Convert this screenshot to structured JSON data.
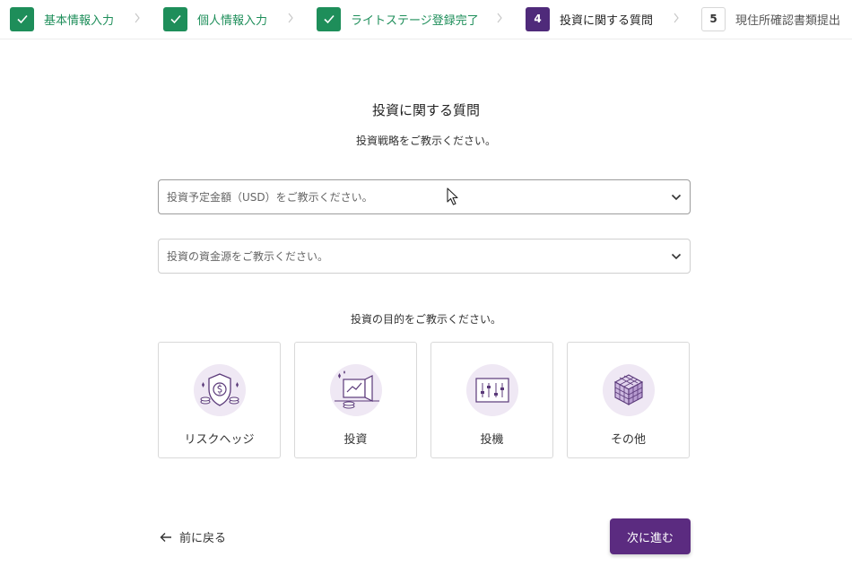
{
  "stepper": {
    "steps": [
      {
        "label": "基本情報入力",
        "status": "done"
      },
      {
        "label": "個人情報入力",
        "status": "done"
      },
      {
        "label": "ライトステージ登録完了",
        "status": "done"
      },
      {
        "number": "4",
        "label": "投資に関する質問",
        "status": "current"
      },
      {
        "number": "5",
        "label": "現住所確認書類提出",
        "status": "future"
      }
    ]
  },
  "main": {
    "title": "投資に関する質問",
    "subtitle": "投資戦略をご教示ください。",
    "amount_select": {
      "placeholder": "投資予定金額（USD）をご教示ください。"
    },
    "source_select": {
      "placeholder": "投資の資金源をご教示ください。"
    },
    "purpose_label": "投資の目的をご教示ください。",
    "purposes": [
      {
        "label": "リスクヘッジ",
        "icon": "shield-dollar-icon"
      },
      {
        "label": "投資",
        "icon": "investment-icon"
      },
      {
        "label": "投機",
        "icon": "sliders-icon"
      },
      {
        "label": "その他",
        "icon": "cube-icon"
      }
    ]
  },
  "footer": {
    "back_label": "前に戻る",
    "next_label": "次に進む"
  },
  "colors": {
    "done": "#1e8e5a",
    "current": "#4f2a7a",
    "primary_button": "#5b2b80",
    "icon_bg": "#efe8f4"
  }
}
